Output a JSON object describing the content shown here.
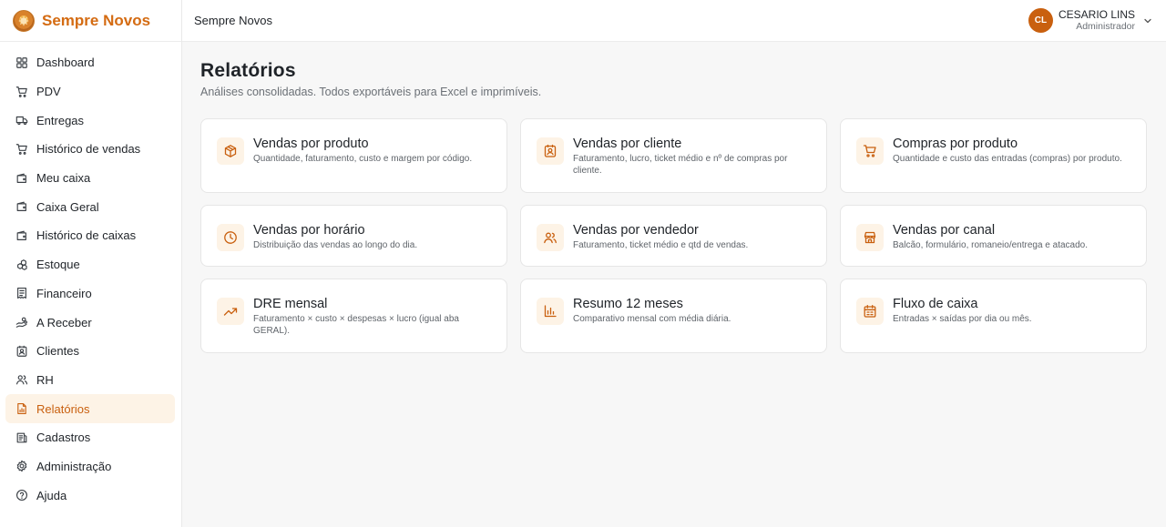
{
  "app": {
    "brand": "Sempre Novos",
    "top_title": "Sempre Novos"
  },
  "user": {
    "initials": "CL",
    "name": "CESARIO LINS",
    "role": "Administrador"
  },
  "colors": {
    "accent": "#c9600f",
    "accent_bg": "#fdf3e6"
  },
  "sidebar": {
    "items": [
      {
        "label": "Dashboard",
        "icon": "grid-icon"
      },
      {
        "label": "PDV",
        "icon": "cart-icon"
      },
      {
        "label": "Entregas",
        "icon": "truck-icon"
      },
      {
        "label": "Histórico de vendas",
        "icon": "cart-icon"
      },
      {
        "label": "Meu caixa",
        "icon": "wallet-icon"
      },
      {
        "label": "Caixa Geral",
        "icon": "wallet-icon"
      },
      {
        "label": "Histórico de caixas",
        "icon": "wallet-icon"
      },
      {
        "label": "Estoque",
        "icon": "boxes-icon"
      },
      {
        "label": "Financeiro",
        "icon": "receipt-icon"
      },
      {
        "label": "A Receber",
        "icon": "hand-coins-icon"
      },
      {
        "label": "Clientes",
        "icon": "contact-icon"
      },
      {
        "label": "RH",
        "icon": "users-icon"
      },
      {
        "label": "Relatórios",
        "icon": "file-chart-icon",
        "active": true
      },
      {
        "label": "Cadastros",
        "icon": "list-icon"
      },
      {
        "label": "Administração",
        "icon": "gear-icon"
      },
      {
        "label": "Ajuda",
        "icon": "help-icon"
      }
    ]
  },
  "page": {
    "title": "Relatórios",
    "subtitle": "Análises consolidadas. Todos exportáveis para Excel e imprimíveis."
  },
  "reports": [
    {
      "title": "Vendas por produto",
      "desc": "Quantidade, faturamento, custo e margem por código.",
      "icon": "package-icon"
    },
    {
      "title": "Vendas por cliente",
      "desc": "Faturamento, lucro, ticket médio e nº de compras por cliente.",
      "icon": "contact-icon"
    },
    {
      "title": "Compras por produto",
      "desc": "Quantidade e custo das entradas (compras) por produto.",
      "icon": "cart-icon"
    },
    {
      "title": "Vendas por horário",
      "desc": "Distribuição das vendas ao longo do dia.",
      "icon": "clock-icon"
    },
    {
      "title": "Vendas por vendedor",
      "desc": "Faturamento, ticket médio e qtd de vendas.",
      "icon": "users-icon"
    },
    {
      "title": "Vendas por canal",
      "desc": "Balcão, formulário, romaneio/entrega e atacado.",
      "icon": "store-icon"
    },
    {
      "title": "DRE mensal",
      "desc": "Faturamento × custo × despesas × lucro (igual aba GERAL).",
      "icon": "trending-up-icon"
    },
    {
      "title": "Resumo 12 meses",
      "desc": "Comparativo mensal com média diária.",
      "icon": "bar-chart-icon"
    },
    {
      "title": "Fluxo de caixa",
      "desc": "Entradas × saídas por dia ou mês.",
      "icon": "calendar-icon"
    }
  ]
}
